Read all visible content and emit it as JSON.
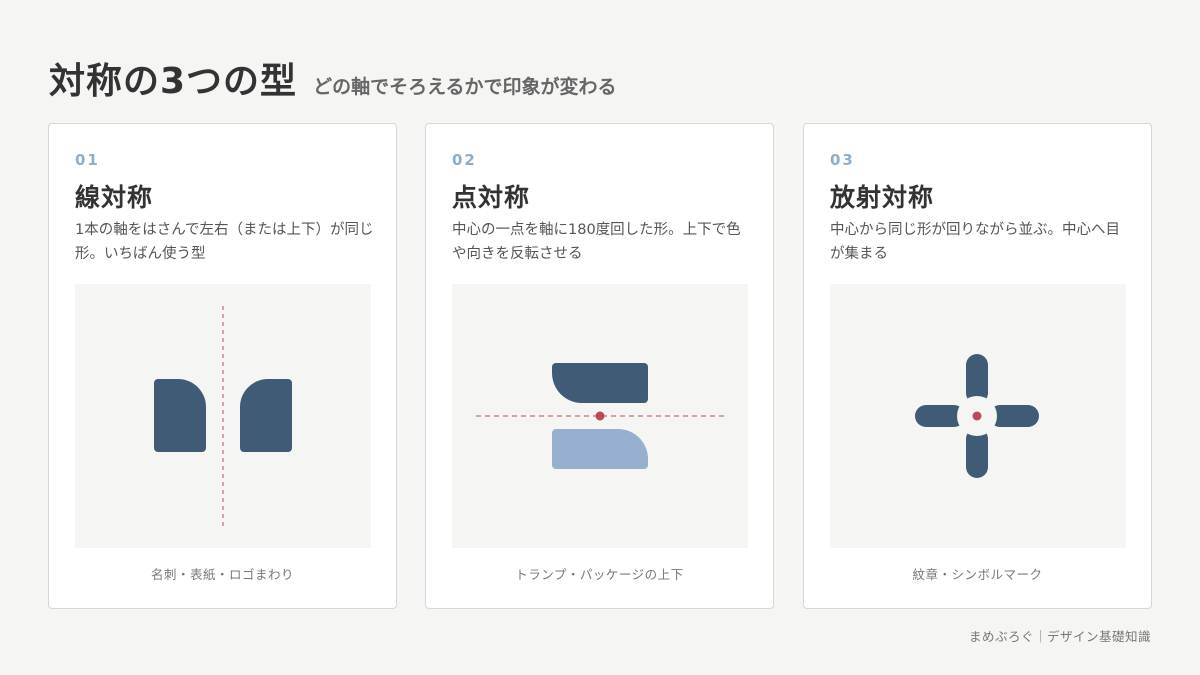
{
  "header": {
    "title": "対称の3つの型",
    "subtitle": "どの軸でそろえるかで印象が変わる"
  },
  "cards": [
    {
      "number": "01",
      "title": "線対称",
      "description": "1本の軸をはさんで左右（または上下）が同じ形。いちばん使う型",
      "caption": "名刺・表紙・ロゴまわり"
    },
    {
      "number": "02",
      "title": "点対称",
      "description": "中心の一点を軸に180度回した形。上下で色や向きを反転させる",
      "caption": "トランプ・パッケージの上下"
    },
    {
      "number": "03",
      "title": "放射対称",
      "description": "中心から同じ形が回りながら並ぶ。中心へ目が集まる",
      "caption": "紋章・シンボルマーク"
    }
  ],
  "footer": "まめぶろぐ｜デザイン基礎知識",
  "colors": {
    "shape_dark": "#3f5b75",
    "shape_light": "#98b0d0",
    "accent": "#b94a5a",
    "panel": "#f5f5f3"
  }
}
